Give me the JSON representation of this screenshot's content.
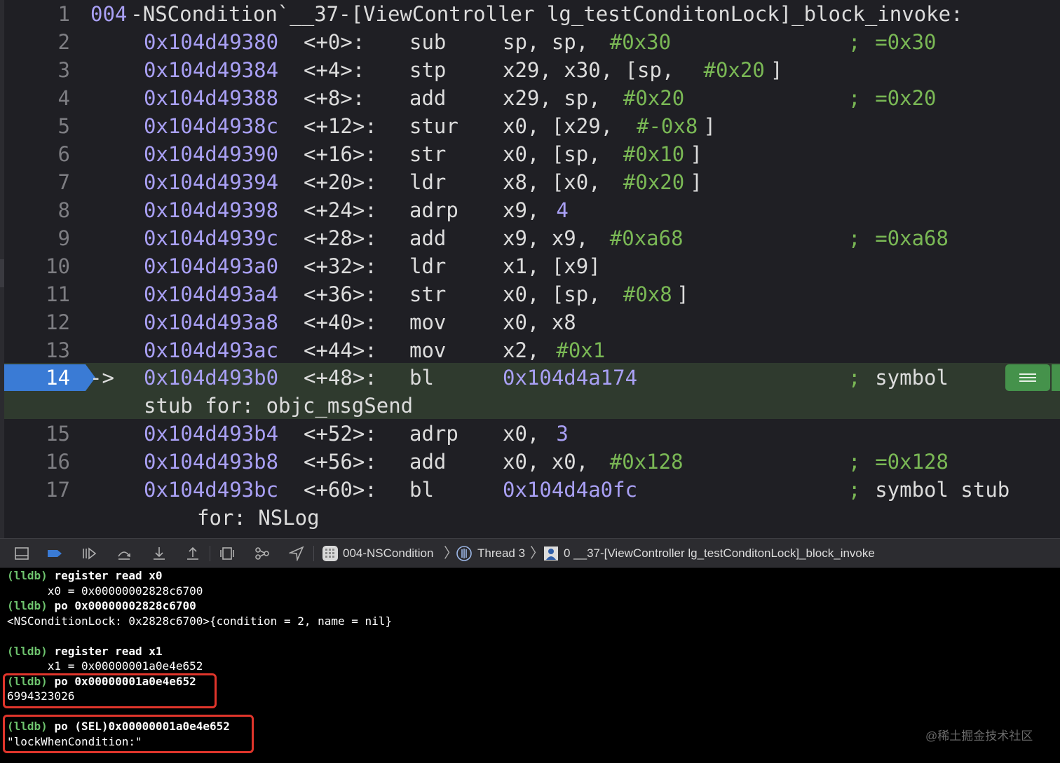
{
  "editor": {
    "header": {
      "line": "1",
      "prefix": "004",
      "rest": "-NSCondition`__37-[ViewController lg_testConditonLock]_block_invoke:"
    },
    "lines": [
      {
        "ln": "2",
        "addr": "0x104d49380",
        "off": "<+0>:",
        "op": "sub",
        "args": [
          [
            "sp, sp, ",
            "p"
          ],
          [
            "#0x30",
            "n"
          ]
        ],
        "cmt": "=0x30"
      },
      {
        "ln": "3",
        "addr": "0x104d49384",
        "off": "<+4>:",
        "op": "stp",
        "args": [
          [
            "x29, x30, [sp, ",
            "p"
          ],
          [
            "#0x20",
            "n"
          ],
          [
            "]",
            "p"
          ]
        ],
        "cmt": ""
      },
      {
        "ln": "4",
        "addr": "0x104d49388",
        "off": "<+8>:",
        "op": "add",
        "args": [
          [
            "x29, sp, ",
            "p"
          ],
          [
            "#0x20",
            "n"
          ]
        ],
        "cmt": "=0x20"
      },
      {
        "ln": "5",
        "addr": "0x104d4938c",
        "off": "<+12>:",
        "op": "stur",
        "args": [
          [
            "x0, [x29, ",
            "p"
          ],
          [
            "#-0x8",
            "n"
          ],
          [
            "]",
            "p"
          ]
        ],
        "cmt": ""
      },
      {
        "ln": "6",
        "addr": "0x104d49390",
        "off": "<+16>:",
        "op": "str",
        "args": [
          [
            "x0, [sp, ",
            "p"
          ],
          [
            "#0x10",
            "n"
          ],
          [
            "]",
            "p"
          ]
        ],
        "cmt": ""
      },
      {
        "ln": "7",
        "addr": "0x104d49394",
        "off": "<+20>:",
        "op": "ldr",
        "args": [
          [
            "x8, [x0, ",
            "p"
          ],
          [
            "#0x20",
            "n"
          ],
          [
            "]",
            "p"
          ]
        ],
        "cmt": ""
      },
      {
        "ln": "8",
        "addr": "0x104d49398",
        "off": "<+24>:",
        "op": "adrp",
        "args": [
          [
            "x9, ",
            "p"
          ],
          [
            "4",
            "s"
          ]
        ],
        "cmt": ""
      },
      {
        "ln": "9",
        "addr": "0x104d4939c",
        "off": "<+28>:",
        "op": "add",
        "args": [
          [
            "x9, x9, ",
            "p"
          ],
          [
            "#0xa68",
            "n"
          ]
        ],
        "cmt": "=0xa68"
      },
      {
        "ln": "10",
        "addr": "0x104d493a0",
        "off": "<+32>:",
        "op": "ldr",
        "args": [
          [
            "x1, [x9]",
            "p"
          ]
        ],
        "cmt": ""
      },
      {
        "ln": "11",
        "addr": "0x104d493a4",
        "off": "<+36>:",
        "op": "str",
        "args": [
          [
            "x0, [sp, ",
            "p"
          ],
          [
            "#0x8",
            "n"
          ],
          [
            "]",
            "p"
          ]
        ],
        "cmt": ""
      },
      {
        "ln": "12",
        "addr": "0x104d493a8",
        "off": "<+40>:",
        "op": "mov",
        "args": [
          [
            "x0, x8",
            "p"
          ]
        ],
        "cmt": ""
      },
      {
        "ln": "13",
        "addr": "0x104d493ac",
        "off": "<+44>:",
        "op": "mov",
        "args": [
          [
            "x2, ",
            "p"
          ],
          [
            "#0x1",
            "n"
          ]
        ],
        "cmt": ""
      }
    ],
    "current": {
      "ln": "14",
      "arrow": "->",
      "addr": "0x104d493b0",
      "off": "<+48>:",
      "op": "bl",
      "target": "0x104d4a174",
      "cmt1": "symbol",
      "cmt2": "stub for: objc_msgSend"
    },
    "after": [
      {
        "ln": "15",
        "addr": "0x104d493b4",
        "off": "<+52>:",
        "op": "adrp",
        "args": [
          [
            "x0, ",
            "p"
          ],
          [
            "3",
            "s"
          ]
        ],
        "cmt": ""
      },
      {
        "ln": "16",
        "addr": "0x104d493b8",
        "off": "<+56>:",
        "op": "add",
        "args": [
          [
            "x0, x0, ",
            "p"
          ],
          [
            "#0x128",
            "n"
          ]
        ],
        "cmt": "=0x128"
      },
      {
        "ln": "17",
        "addr": "0x104d493bc",
        "off": "<+60>:",
        "op": "bl",
        "args": [
          [
            "0x104d4a0fc",
            "s"
          ]
        ],
        "cmt": "symbol stub",
        "cont": "for: NSLog"
      }
    ]
  },
  "toolbar": {
    "target": "004-NSCondition",
    "thread": "Thread 3",
    "frame": "0 __37-[ViewController lg_testConditonLock]_block_invoke",
    "chevron": "〉"
  },
  "console": {
    "lines": [
      {
        "prompt": "(lldb)",
        "cmd": "register read x0"
      },
      {
        "text": "      x0 = 0x00000002828c6700"
      },
      {
        "prompt": "(lldb)",
        "cmd": "po 0x00000002828c6700"
      },
      {
        "text": "<NSConditionLock: 0x2828c6700>{condition = 2, name = nil}"
      },
      {
        "text": ""
      },
      {
        "prompt": "(lldb)",
        "cmd": "register read x1"
      },
      {
        "text": "      x1 = 0x00000001a0e4e652"
      },
      {
        "prompt": "(lldb)",
        "cmd": "po 0x00000001a0e4e652"
      },
      {
        "text": "6994323026"
      },
      {
        "text": ""
      },
      {
        "prompt": "(lldb)",
        "cmd": "po (SEL)0x00000001a0e4e652"
      },
      {
        "text": "\"lockWhenCondition:\""
      }
    ]
  },
  "watermark": "@稀土掘金技术社区",
  "colors": {
    "address": "#a9a0f5",
    "number": "#7ab855",
    "current_line": "#2f3a2e",
    "breakpoint": "#3a7bd5",
    "highlight_box": "#e0352b"
  }
}
